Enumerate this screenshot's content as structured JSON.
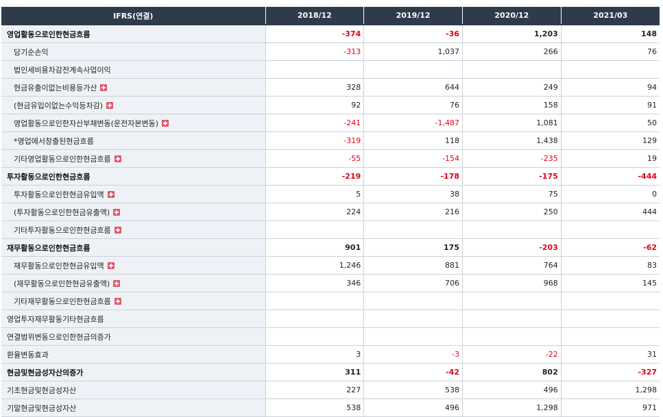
{
  "header": {
    "title": "IFRS(연결)",
    "periods": [
      "2018/12",
      "2019/12",
      "2020/12",
      "2021/03"
    ]
  },
  "rows": [
    {
      "label": "영업활동으로인한현금흐름",
      "bold": true,
      "indent": false,
      "expand": false,
      "values": [
        "-374",
        "-36",
        "1,203",
        "148"
      ]
    },
    {
      "label": "당기순손익",
      "bold": false,
      "indent": true,
      "expand": false,
      "values": [
        "-313",
        "1,037",
        "266",
        "76"
      ]
    },
    {
      "label": "법인세비용차감전계속사업이익",
      "bold": false,
      "indent": true,
      "expand": false,
      "values": [
        "",
        "",
        "",
        ""
      ]
    },
    {
      "label": "현금유출이없는비용등가산",
      "bold": false,
      "indent": true,
      "expand": true,
      "values": [
        "328",
        "644",
        "249",
        "94"
      ]
    },
    {
      "label": "(현금유입이없는수익등차감)",
      "bold": false,
      "indent": true,
      "expand": true,
      "values": [
        "92",
        "76",
        "158",
        "91"
      ]
    },
    {
      "label": "영업활동으로인한자산부채변동(운전자본변동)",
      "bold": false,
      "indent": true,
      "expand": true,
      "values": [
        "-241",
        "-1,487",
        "1,081",
        "50"
      ]
    },
    {
      "label": "*영업에서창출된현금흐름",
      "bold": false,
      "indent": true,
      "expand": false,
      "values": [
        "-319",
        "118",
        "1,438",
        "129"
      ]
    },
    {
      "label": "기타영업활동으로인한현금흐름",
      "bold": false,
      "indent": true,
      "expand": true,
      "values": [
        "-55",
        "-154",
        "-235",
        "19"
      ]
    },
    {
      "label": "투자활동으로인한현금흐름",
      "bold": true,
      "indent": false,
      "expand": false,
      "values": [
        "-219",
        "-178",
        "-175",
        "-444"
      ]
    },
    {
      "label": "투자활동으로인한현금유입액",
      "bold": false,
      "indent": true,
      "expand": true,
      "values": [
        "5",
        "38",
        "75",
        "0"
      ]
    },
    {
      "label": "(투자활동으로인한현금유출액)",
      "bold": false,
      "indent": true,
      "expand": true,
      "values": [
        "224",
        "216",
        "250",
        "444"
      ]
    },
    {
      "label": "기타투자활동으로인한현금흐름",
      "bold": false,
      "indent": true,
      "expand": true,
      "values": [
        "",
        "",
        "",
        ""
      ]
    },
    {
      "label": "재무활동으로인한현금흐름",
      "bold": true,
      "indent": false,
      "expand": false,
      "values": [
        "901",
        "175",
        "-203",
        "-62"
      ]
    },
    {
      "label": "재무활동으로인한현금유입액",
      "bold": false,
      "indent": true,
      "expand": true,
      "values": [
        "1,246",
        "881",
        "764",
        "83"
      ]
    },
    {
      "label": "(재무활동으로인한현금유출액)",
      "bold": false,
      "indent": true,
      "expand": true,
      "values": [
        "346",
        "706",
        "968",
        "145"
      ]
    },
    {
      "label": "기타재무활동으로인한현금흐름",
      "bold": false,
      "indent": true,
      "expand": true,
      "values": [
        "",
        "",
        "",
        ""
      ]
    },
    {
      "label": "영업투자재무활동기타현금흐름",
      "bold": false,
      "indent": false,
      "expand": false,
      "values": [
        "",
        "",
        "",
        ""
      ]
    },
    {
      "label": "연결범위변동으로인한현금의증가",
      "bold": false,
      "indent": false,
      "expand": false,
      "values": [
        "",
        "",
        "",
        ""
      ]
    },
    {
      "label": "환율변동효과",
      "bold": false,
      "indent": false,
      "expand": false,
      "values": [
        "3",
        "-3",
        "-22",
        "31"
      ]
    },
    {
      "label": "현금및현금성자산의증가",
      "bold": true,
      "indent": false,
      "expand": false,
      "values": [
        "311",
        "-42",
        "802",
        "-327"
      ]
    },
    {
      "label": "기초현금및현금성자산",
      "bold": false,
      "indent": false,
      "expand": false,
      "values": [
        "227",
        "538",
        "496",
        "1,298"
      ]
    },
    {
      "label": "기말현금및현금성자산",
      "bold": false,
      "indent": false,
      "expand": false,
      "values": [
        "538",
        "496",
        "1,298",
        "971"
      ]
    }
  ],
  "colors": {
    "header_bg": "#2d3b4a",
    "label_bg": "#eef2f6",
    "negative": "#e2001a",
    "expand_icon": "#e0566c"
  }
}
